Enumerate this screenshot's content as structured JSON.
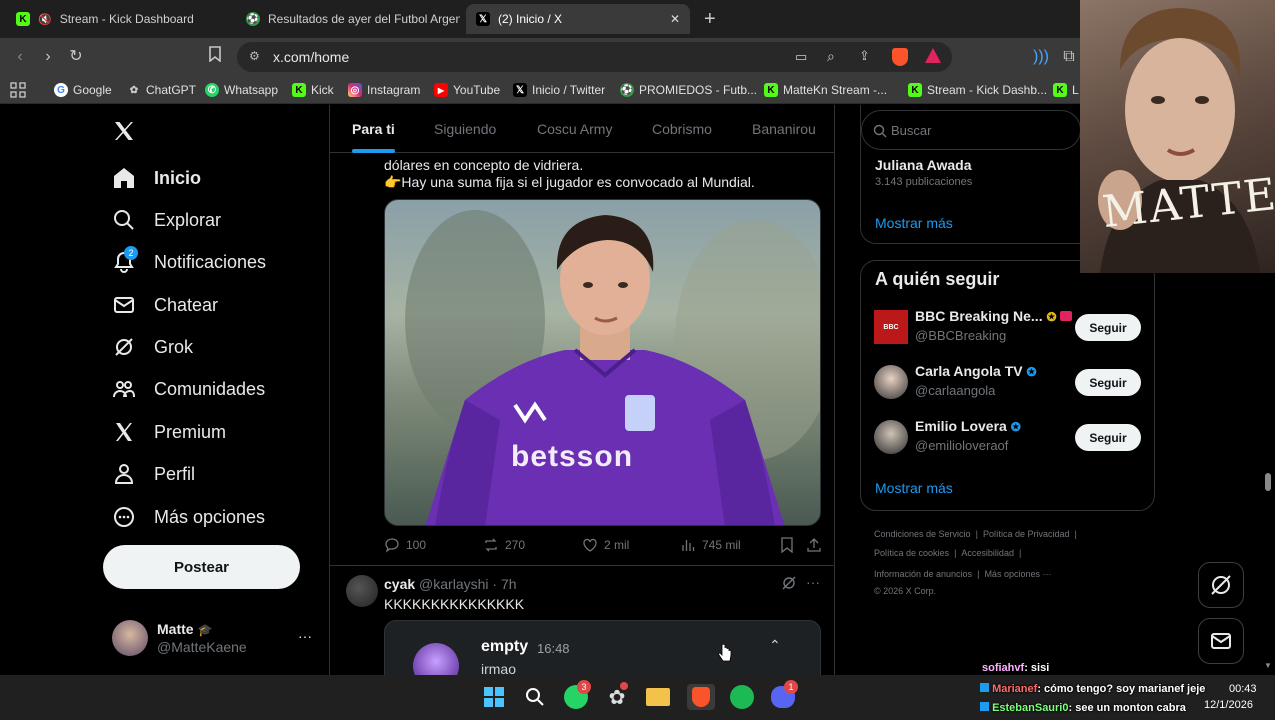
{
  "browser": {
    "tabs": [
      {
        "title": "Stream - Kick Dashboard",
        "favicon": "kick-icon"
      },
      {
        "title": "Resultados de ayer del Futbol Argent",
        "favicon": "soccer-icon"
      },
      {
        "title": "(2) Inicio / X",
        "favicon": "x-icon"
      }
    ],
    "new_tab": "+",
    "close": "✕",
    "url": "x.com/home",
    "bookmarks": [
      {
        "label": "Google",
        "icon": "google-icon"
      },
      {
        "label": "ChatGPT",
        "icon": "chatgpt-icon"
      },
      {
        "label": "Whatsapp",
        "icon": "whatsapp-icon"
      },
      {
        "label": "Kick",
        "icon": "kick-icon"
      },
      {
        "label": "Instagram",
        "icon": "instagram-icon"
      },
      {
        "label": "YouTube",
        "icon": "youtube-icon"
      },
      {
        "label": "Inicio / Twitter",
        "icon": "x-icon"
      },
      {
        "label": "PROMIEDOS - Futb...",
        "icon": "soccer-icon"
      },
      {
        "label": "MatteKn Stream -...",
        "icon": "kick-icon"
      },
      {
        "label": "Stream - Kick Dashb...",
        "icon": "kick-icon"
      },
      {
        "label": "L",
        "icon": "kick-icon"
      }
    ]
  },
  "x": {
    "nav": [
      {
        "label": "Inicio",
        "icon": "home-icon"
      },
      {
        "label": "Explorar",
        "icon": "search-icon"
      },
      {
        "label": "Notificaciones",
        "icon": "bell-icon",
        "badge": "2"
      },
      {
        "label": "Chatear",
        "icon": "mail-icon"
      },
      {
        "label": "Grok",
        "icon": "grok-icon"
      },
      {
        "label": "Comunidades",
        "icon": "communities-icon"
      },
      {
        "label": "Premium",
        "icon": "x-logo-icon"
      },
      {
        "label": "Perfil",
        "icon": "person-icon"
      },
      {
        "label": "Más opciones",
        "icon": "more-circle-icon"
      }
    ],
    "post_button": "Postear",
    "account": {
      "name": "Matte",
      "emoji": "🎓",
      "handle": "@MatteKaene",
      "more": "···"
    },
    "feed_tabs": [
      "Para ti",
      "Siguiendo",
      "Coscu Army",
      "Cobrismo",
      "Bananirou"
    ],
    "tweet1": {
      "line1": "dólares en concepto de vidriera.",
      "line2": "👉Hay una suma fija si el jugador es convocado al Mundial.",
      "image_text": "betsson",
      "replies": "100",
      "retweets": "270",
      "likes": "2 mil",
      "views": "745 mil"
    },
    "tweet2": {
      "name": "cyak",
      "handle": "@karlayshi",
      "time": "· 7h",
      "text": "KKKKKKKKKKKKKKK",
      "embed_name": "empty",
      "embed_time": "16:48",
      "embed_text": "irmao"
    },
    "search_placeholder": "Buscar",
    "trend": {
      "name": "Juliana Awada",
      "count": "3.143 publicaciones",
      "more": "Mostrar más"
    },
    "who_to_follow": {
      "title": "A quién seguir",
      "items": [
        {
          "name": "BBC Breaking Ne...",
          "handle": "@BBCBreaking",
          "button": "Seguir",
          "verified": "gold"
        },
        {
          "name": "Carla Angola TV",
          "handle": "@carlaangola",
          "button": "Seguir",
          "verified": "blue"
        },
        {
          "name": "Emilio Lovera",
          "handle": "@emilioloveraof",
          "button": "Seguir",
          "verified": "blue"
        }
      ],
      "more": "Mostrar más"
    },
    "footer": [
      "Condiciones de Servicio",
      "|",
      "Política de Privacidad",
      "|",
      "Política de cookies",
      "|",
      "Accesibilidad",
      "|",
      "Información de anuncios",
      "|",
      "Más opciones ···",
      "© 2026 X Corp."
    ]
  },
  "overlay": {
    "webcam_text": "MATTE",
    "chat": [
      {
        "user": "sofiahvf",
        "msg": ": sisi",
        "color": "#ffb3ff"
      },
      {
        "user": "Marianef",
        "msg": ": cómo tengo? soy marianef jeje",
        "color": "#ff6b6b"
      },
      {
        "user": "EstebanSauri0",
        "msg": ": see un monton cabra",
        "color": "#7cff7c"
      }
    ]
  },
  "taskbar": {
    "clock_time": "00:43",
    "clock_date": "12/1/2026",
    "whatsapp_badge": "3",
    "discord_badge": "1"
  }
}
